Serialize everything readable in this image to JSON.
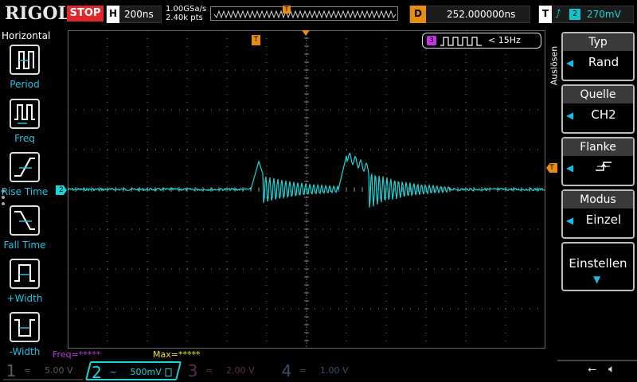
{
  "brand": "RIGOL",
  "run_state": "STOP",
  "horizontal": {
    "key": "H",
    "timebase": "200ns",
    "sample_rate": "1.00GSa/s",
    "mem_depth": "2.40k pts"
  },
  "delay": {
    "key": "D",
    "value": "252.000000ns"
  },
  "trigger": {
    "key": "T",
    "edge_icon": "rising-edge-icon",
    "source": "2",
    "level": "270mV",
    "marker": "T",
    "marker_color": "#e98d11"
  },
  "left_menu": {
    "title": "Horizontal",
    "items": [
      {
        "label": "Period",
        "icon": "period-measure-icon"
      },
      {
        "label": "Freq",
        "icon": "frequency-measure-icon"
      },
      {
        "label": "Rise Time",
        "icon": "rise-time-icon"
      },
      {
        "label": "Fall Time",
        "icon": "fall-time-icon"
      },
      {
        "label": "+Width",
        "icon": "positive-width-icon"
      },
      {
        "label": "-Width",
        "icon": "negative-width-icon"
      }
    ]
  },
  "right_menu": {
    "side_title": "Auslösen",
    "items": [
      {
        "header": "Typ",
        "value": "Rand"
      },
      {
        "header": "Quelle",
        "value": "CH2"
      },
      {
        "header": "Flanke",
        "value": "",
        "icon": "rising-edge-icon"
      },
      {
        "header": "Modus",
        "value": "Einzel"
      }
    ],
    "settings_label": "Einstellen"
  },
  "counter": {
    "channel": "3",
    "text": "< 15Hz"
  },
  "channel_marker": "2",
  "measurements": {
    "freq": "Freq=*****",
    "max": "Max=*****"
  },
  "channels": [
    {
      "num": "1",
      "coupling": "=",
      "scale": "5.00 V",
      "color": "#5d5d50"
    },
    {
      "num": "2",
      "coupling": "~",
      "scale": "500mV",
      "color": "#19d7d9"
    },
    {
      "num": "3",
      "coupling": "=",
      "scale": "2.00 V",
      "color": "#55304f"
    },
    {
      "num": "4",
      "coupling": "=",
      "scale": "1.00 V",
      "color": "#3a4f66"
    }
  ],
  "colors": {
    "ch2": "#19d7d9",
    "ch3": "#c436e6",
    "trigger": "#e98d11",
    "menu_accent": "#1ec3e6"
  }
}
